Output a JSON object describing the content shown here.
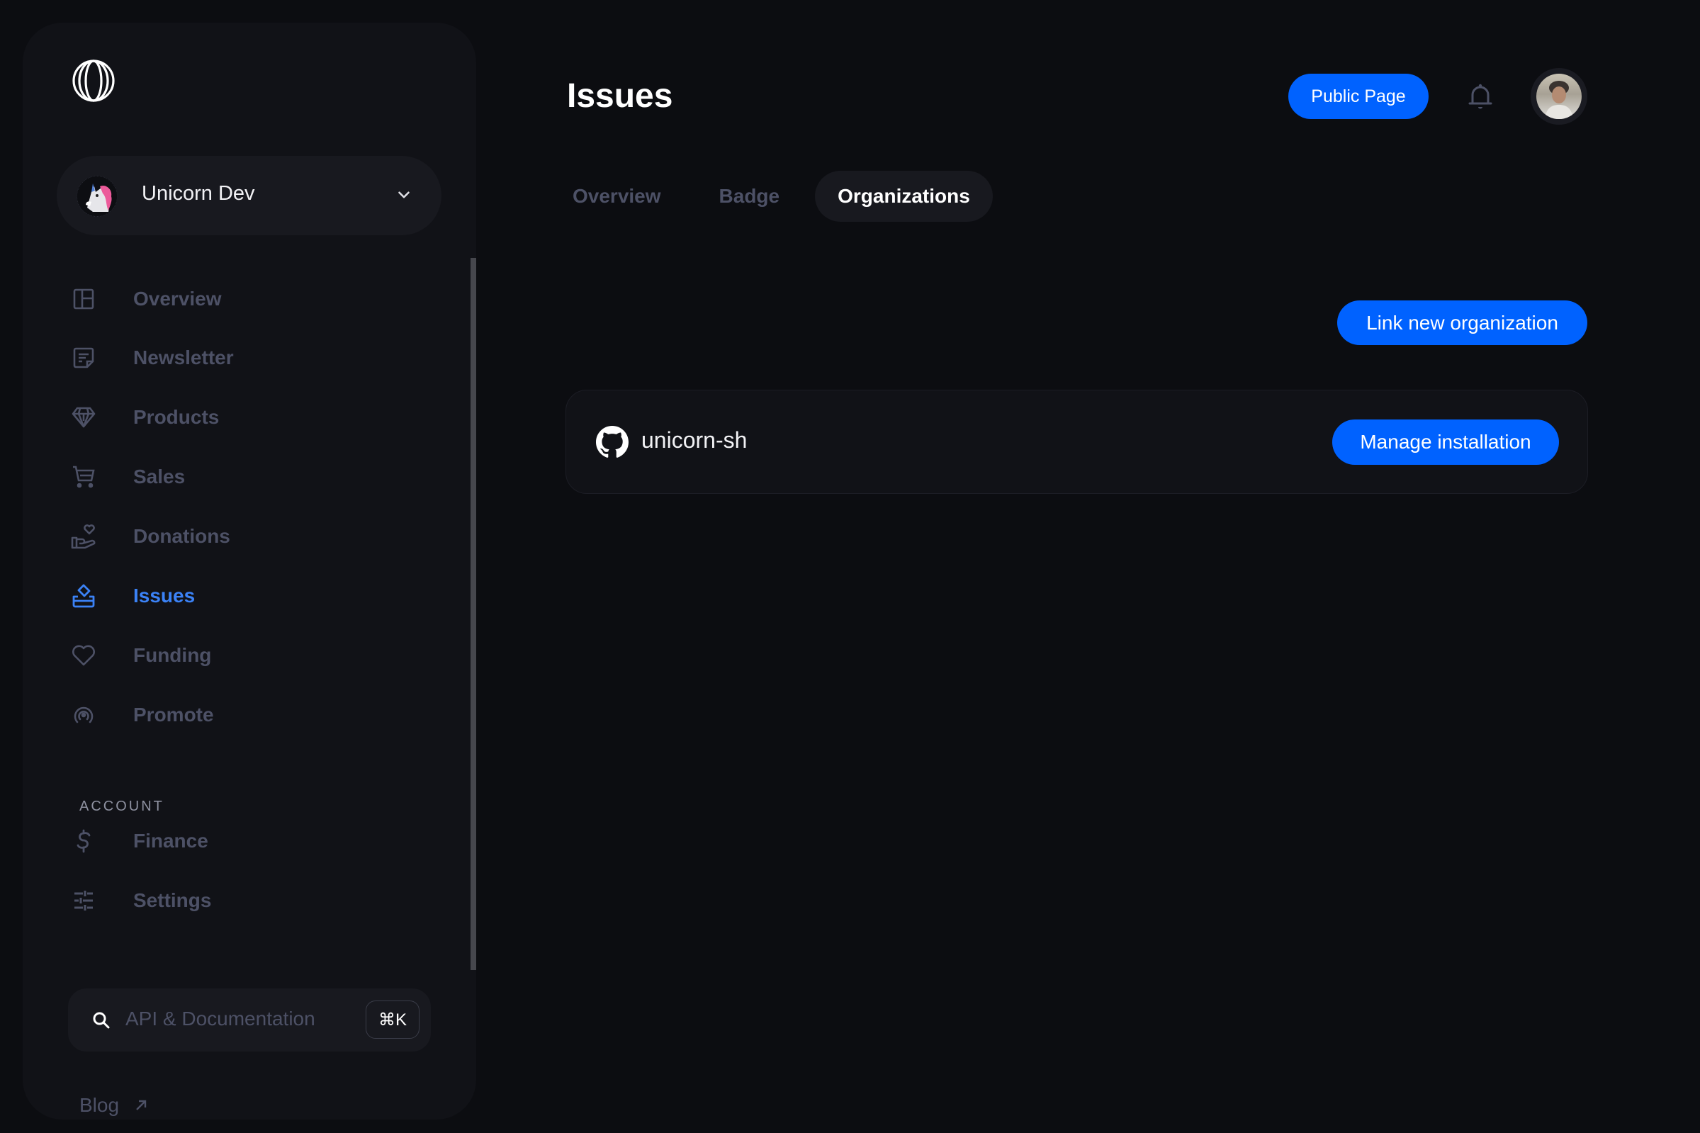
{
  "sidebar": {
    "logo_icon": "polar-globe-logo",
    "workspace": {
      "name": "Unicorn Dev",
      "avatar_icon": "unicorn-avatar",
      "chevron_icon": "chevron-down-icon"
    },
    "nav_items": [
      {
        "label": "Overview",
        "icon": "layout-icon",
        "active": false
      },
      {
        "label": "Newsletter",
        "icon": "note-icon",
        "active": false
      },
      {
        "label": "Products",
        "icon": "diamond-icon",
        "active": false
      },
      {
        "label": "Sales",
        "icon": "cart-icon",
        "active": false
      },
      {
        "label": "Donations",
        "icon": "hand-heart-icon",
        "active": false
      },
      {
        "label": "Issues",
        "icon": "ballot-icon",
        "active": true
      },
      {
        "label": "Funding",
        "icon": "heart-icon",
        "active": false
      },
      {
        "label": "Promote",
        "icon": "broadcast-icon",
        "active": false
      }
    ],
    "account_section": {
      "label": "ACCOUNT",
      "items": [
        {
          "label": "Finance",
          "icon": "dollar-icon"
        },
        {
          "label": "Settings",
          "icon": "sliders-icon"
        }
      ]
    },
    "search": {
      "placeholder": "API & Documentation",
      "shortcut": "⌘K"
    },
    "blog_link": {
      "label": "Blog",
      "icon": "external-arrow-icon"
    }
  },
  "header": {
    "title": "Issues",
    "public_page_label": "Public Page",
    "notifications_icon": "bell-icon",
    "user_avatar": "user-avatar"
  },
  "tabs": [
    {
      "label": "Overview",
      "active": false
    },
    {
      "label": "Badge",
      "active": false
    },
    {
      "label": "Organizations",
      "active": true
    }
  ],
  "main": {
    "link_org_label": "Link new organization",
    "organizations": [
      {
        "name": "unicorn-sh",
        "icon": "github-icon",
        "action_label": "Manage installation"
      }
    ]
  },
  "colors": {
    "accent": "#0062ff",
    "active_nav": "#3b82f6",
    "muted_text": "#4d5166",
    "background": "#0c0d11",
    "panel": "#111217"
  }
}
